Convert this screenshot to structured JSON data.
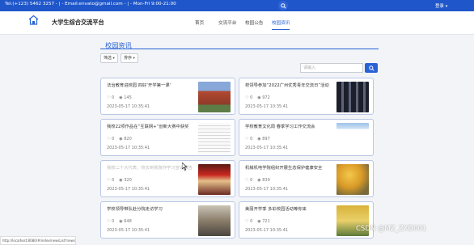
{
  "topbar": {
    "contact": "Tel:(+123) 5462 3257 - | - Email:envato@gmail.com - | - Mon-Fri 9:00-21:00",
    "login": "登录"
  },
  "header": {
    "site_title": "大学生综合交流平台",
    "nav": [
      "首页",
      "交流平台",
      "校园公告",
      "校园资讯"
    ],
    "active_nav": 3
  },
  "section": {
    "title": "校园资讯"
  },
  "filters": {
    "filter_label": "筛选",
    "sort_label": "排序"
  },
  "search": {
    "placeholder": "请输入"
  },
  "cards": [
    {
      "title": "法治教育进校园 四好‘开学第一课’",
      "likes": "0",
      "views": "145",
      "date": "2023-05-17 10:35:41",
      "image_icon": "campus-building-photo"
    },
    {
      "title": "校领导参加“2022广州优秀青年交流日”活动",
      "likes": "0",
      "views": "972",
      "date": "2023-05-17 10:35:41",
      "image_icon": "conference-screen-photo"
    },
    {
      "title": "我校22项作品在“互联网+”创新大赛中获奖",
      "likes": "0",
      "views": "820",
      "date": "2023-05-17 10:35:41",
      "image_icon": "document-photo"
    },
    {
      "title": "学校教育文化周 春季学习工作交流会",
      "likes": "0",
      "views": "897",
      "date": "2023-05-17 10:35:41",
      "image_icon": "sky-photo"
    },
    {
      "title": "我校二十大代表、校长到我院作学习宣讲报告",
      "likes": "0",
      "views": "320",
      "date": "2023-05-17 10:35:41",
      "image_icon": "auditorium-photo"
    },
    {
      "title": "机械机电学院组织开展生态保护健康安全",
      "likes": "0",
      "views": "839",
      "date": "2023-05-17 10:35:41",
      "image_icon": "autumn-trees-photo"
    },
    {
      "title": "学校领导带队赴分院走访学习",
      "likes": "0",
      "views": "648",
      "date": "2023-05-17 10:35:41",
      "image_icon": "meeting-photo"
    },
    {
      "title": "美丽开学季 多彩校园活动等你来",
      "likes": "0",
      "views": "721",
      "date": "2023-05-17 10:35:41",
      "image_icon": "flowers-photo"
    }
  ],
  "statusbar": {
    "url": "http://localhost:8080/#/index/newsList?newsType=1"
  },
  "watermark": "CSDN @MZ_ZXD001",
  "colors": {
    "primary": "#2a62d6",
    "topbar": "#1f56c9"
  }
}
